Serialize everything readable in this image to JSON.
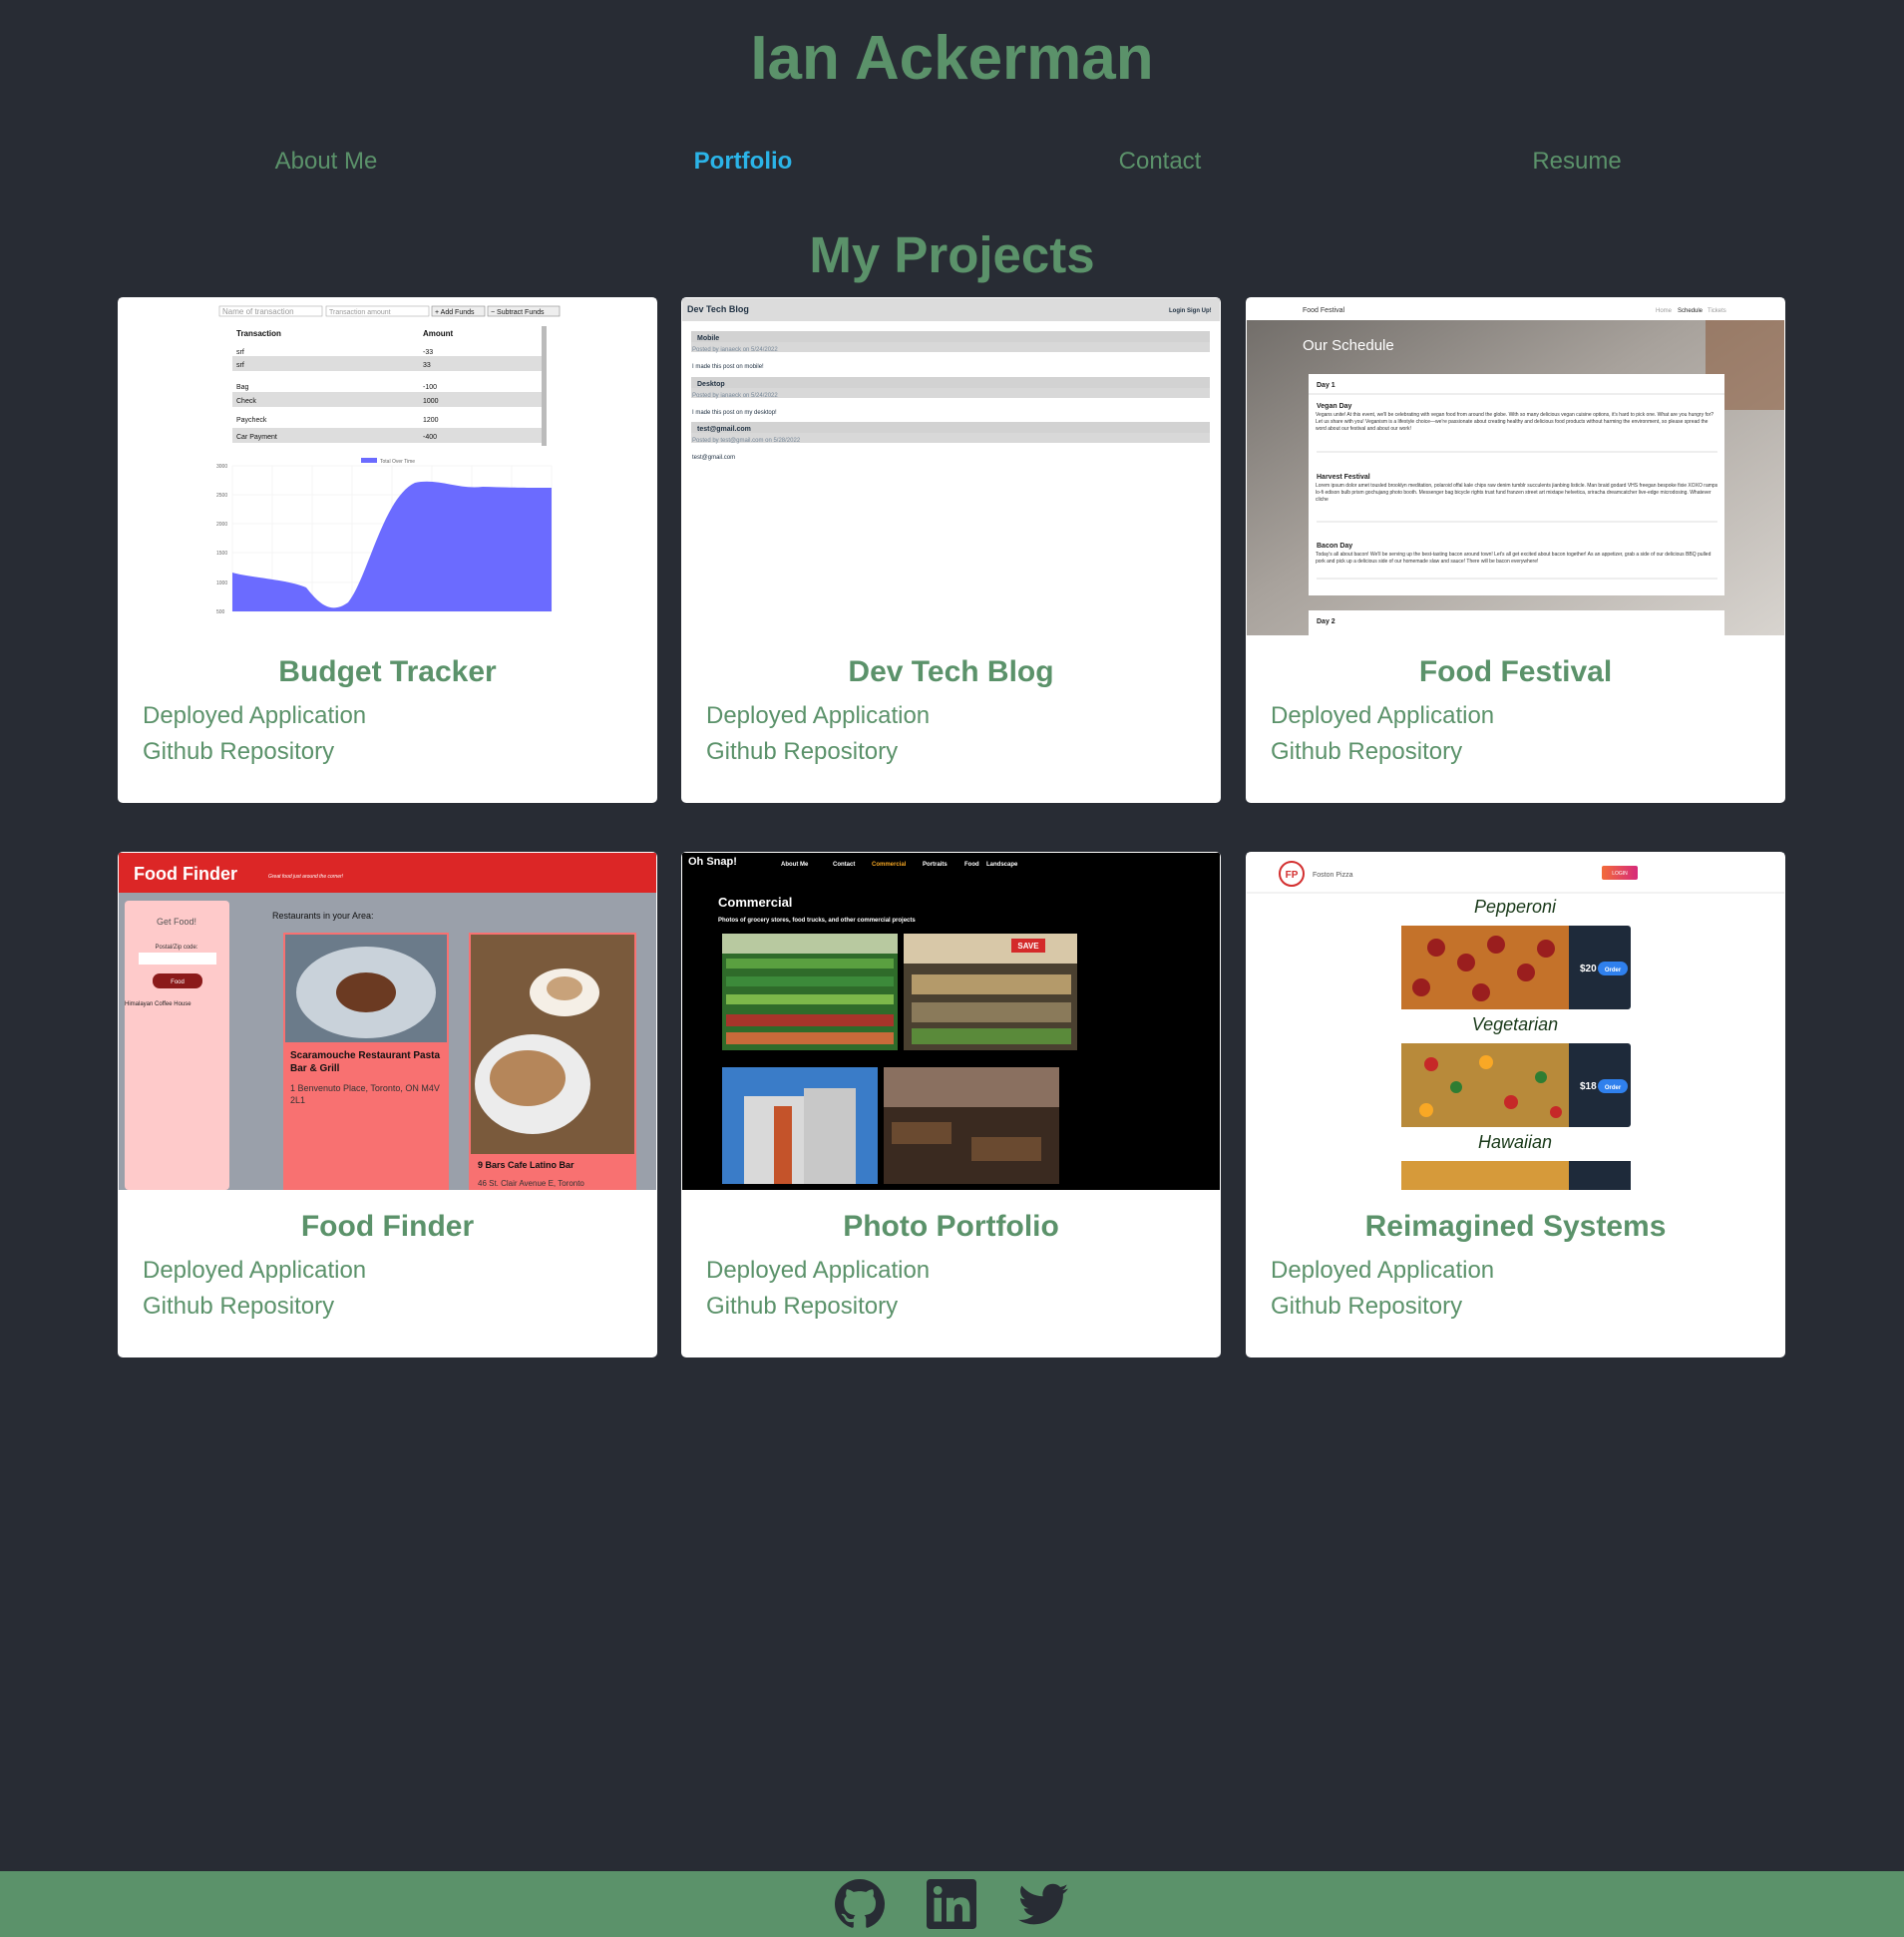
{
  "header": {
    "title": "Ian Ackerman"
  },
  "nav": {
    "items": [
      {
        "label": "About Me"
      },
      {
        "label": "Portfolio"
      },
      {
        "label": "Contact"
      },
      {
        "label": "Resume"
      }
    ]
  },
  "projects": {
    "title": "My Projects",
    "items": [
      {
        "name": "Budget Tracker",
        "deployed_label": "Deployed Application",
        "repo_label": "Github Repository"
      },
      {
        "name": "Dev Tech Blog",
        "deployed_label": "Deployed Application",
        "repo_label": "Github Repository"
      },
      {
        "name": "Food Festival",
        "deployed_label": "Deployed Application",
        "repo_label": "Github Repository"
      },
      {
        "name": "Food Finder",
        "deployed_label": "Deployed Application",
        "repo_label": "Github Repository"
      },
      {
        "name": "Photo Portfolio",
        "deployed_label": "Deployed Application",
        "repo_label": "Github Repository"
      },
      {
        "name": "Reimagined Systems",
        "deployed_label": "Deployed Application",
        "repo_label": "Github Repository"
      }
    ]
  },
  "screenshots": {
    "budget": {
      "name_placeholder": "Name of transaction",
      "amount_placeholder": "Transaction amount",
      "add_label": "+ Add Funds",
      "subtract_label": "− Subtract Funds",
      "col_transaction": "Transaction",
      "col_amount": "Amount",
      "rows": [
        {
          "name": "srf",
          "amount": "-33"
        },
        {
          "name": "srf",
          "amount": "33"
        },
        {
          "name": "Bag",
          "amount": "-100"
        },
        {
          "name": "Check",
          "amount": "1000"
        },
        {
          "name": "Paycheck",
          "amount": "1200"
        },
        {
          "name": "Car Payment",
          "amount": "-400"
        }
      ],
      "legend": "Total Over Time",
      "y_ticks": [
        "3000",
        "2500",
        "2000",
        "1500",
        "1000",
        "500"
      ]
    },
    "blog": {
      "title": "Dev Tech Blog",
      "nav": "Login Sign Up!",
      "posts": [
        {
          "title": "Mobile",
          "meta": "Posted by ianaeck on 5/24/2022",
          "body": "I made this post on mobile!"
        },
        {
          "title": "Desktop",
          "meta": "Posted by ianaeck on 5/24/2022",
          "body": "I made this post on my desktop!"
        },
        {
          "title": "test@gmail.com",
          "meta": "Posted by test@gmail.com on 5/28/2022",
          "body": "test@gmail.com"
        }
      ]
    },
    "festival": {
      "brand": "Food Festival",
      "nav": [
        "Home",
        "Schedule",
        "Tickets"
      ],
      "heading": "Our Schedule",
      "day1": "Day 1",
      "events": [
        {
          "title": "Vegan Day",
          "body": "Vegans unite! At this event, we'll be celebrating with vegan food from around the globe. With so many delicious vegan cuisine options, it's hard to pick one. What are you hungry for? Let us share with you! Veganism is a lifestyle choice—we're passionate about creating healthy and delicious food products without harming the environment, so please spread the word about our festival and about our work!"
        },
        {
          "title": "Harvest Festival",
          "body": "Lorem ipsum dolor amet tousled brooklyn meditation, polaroid offal kale chips raw denim tumblr succulents jianbing listicle. Man braid godard VHS freegan bespoke fixie XOXO ramps lo-fi edison bulb prism gochujang photo booth. Messenger bag bicycle rights trust fund franzen street art mixtape helvetica, sriracha dreamcatcher live-edge microdosing. Whatever cliche"
        },
        {
          "title": "Bacon Day",
          "body": "Today's all about bacon! We'll be serving up the best-tasting bacon around town! Let's all get excited about bacon together! As an appetizer, grab a side of our delicious BBQ pulled pork and pick up a delicious side of our homemade slaw and sauce! There will be bacon everywhere!"
        }
      ],
      "day2": "Day 2"
    },
    "finder": {
      "brand": "Food Finder",
      "tagline": "Great food just around the corner!",
      "panel_title": "Get Food!",
      "postal_label": "Postal/Zip code:",
      "button": "Food",
      "result": "Himalayan Coffee House",
      "section": "Restaurants in your Area:",
      "card1_name": "Scaramouche Restaurant Pasta Bar & Grill",
      "card1_addr": "1 Benvenuto Place, Toronto, ON M4V 2L1",
      "card2_name": "9 Bars Cafe Latino Bar",
      "card2_addr": "46 St. Clair Avenue E, Toronto"
    },
    "photo": {
      "brand": "Oh Snap!",
      "nav": [
        "About Me",
        "Contact",
        "Commercial",
        "Portraits",
        "Food",
        "Landscape"
      ],
      "heading": "Commercial",
      "sub": "Photos of grocery stores, food trucks, and other commercial projects",
      "sign": "SAVE"
    },
    "pizza": {
      "brand": "Foston Pizza",
      "logo": "FP",
      "login": "LOGIN",
      "items": [
        {
          "name": "Pepperoni",
          "price": "$20",
          "button": "Order"
        },
        {
          "name": "Vegetarian",
          "price": "$18",
          "button": "Order"
        },
        {
          "name": "Hawaiian"
        }
      ]
    }
  },
  "footer": {
    "icons": [
      "github-icon",
      "linkedin-icon",
      "twitter-icon"
    ]
  },
  "colors": {
    "background": "#282c34",
    "accent": "#5b926a",
    "active": "#2bb4e8",
    "footer": "#5b926a"
  }
}
